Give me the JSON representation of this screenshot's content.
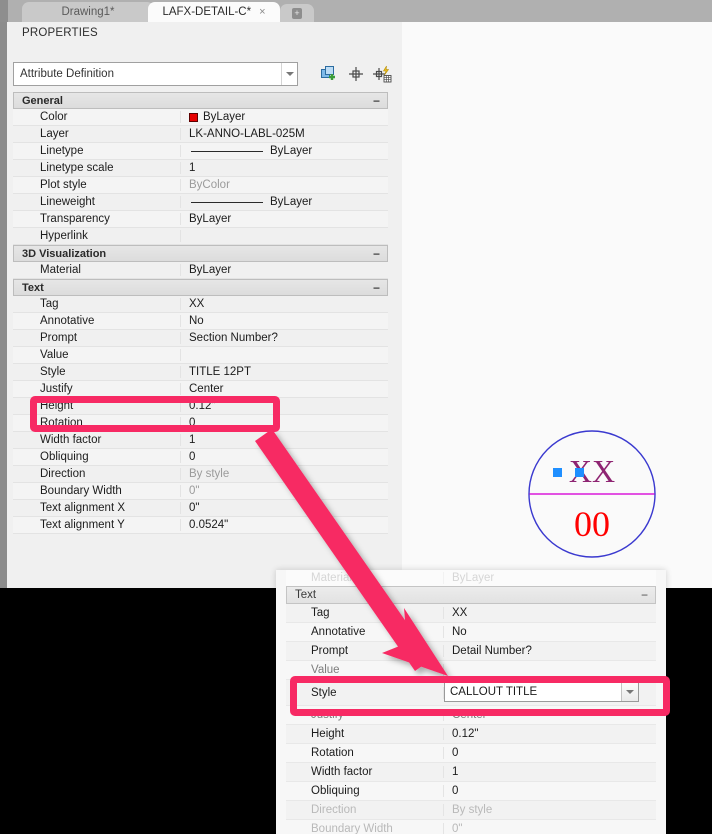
{
  "window": {
    "tabs": [
      {
        "label": "Drawing1*",
        "active": false
      },
      {
        "label": "LAFX-DETAIL-C*",
        "active": true,
        "close": "×"
      }
    ],
    "new_tab_glyph": "+"
  },
  "palette": {
    "title": "PROPERTIES",
    "object_type": "Attribute Definition",
    "toolbar": {
      "select_objects": "select-objects-icon",
      "quick_select": "quick-select-icon",
      "quick_select_calc": "quick-select-calc-icon"
    },
    "categories": [
      {
        "name": "General",
        "collapse": "−",
        "rows": [
          {
            "name": "Color",
            "value": "ByLayer",
            "swatch": "#e60000"
          },
          {
            "name": "Layer",
            "value": "LK-ANNO-LABL-025M"
          },
          {
            "name": "Linetype",
            "value": "ByLayer",
            "line": true
          },
          {
            "name": "Linetype scale",
            "value": "1"
          },
          {
            "name": "Plot style",
            "value": "ByColor",
            "dim": true
          },
          {
            "name": "Lineweight",
            "value": "ByLayer",
            "line": true
          },
          {
            "name": "Transparency",
            "value": "ByLayer"
          },
          {
            "name": "Hyperlink",
            "value": ""
          }
        ]
      },
      {
        "name": "3D Visualization",
        "collapse": "−",
        "rows": [
          {
            "name": "Material",
            "value": "ByLayer"
          }
        ]
      },
      {
        "name": "Text",
        "collapse": "−",
        "rows": [
          {
            "name": "Tag",
            "value": "XX"
          },
          {
            "name": "Annotative",
            "value": "No"
          },
          {
            "name": "Prompt",
            "value": "Section Number?"
          },
          {
            "name": "Value",
            "value": ""
          },
          {
            "name": "Style",
            "value": "TITLE 12PT",
            "highlighted": true
          },
          {
            "name": "Justify",
            "value": "Center"
          },
          {
            "name": "Height",
            "value": "0.12\""
          },
          {
            "name": "Rotation",
            "value": "0"
          },
          {
            "name": "Width factor",
            "value": "1"
          },
          {
            "name": "Obliquing",
            "value": "0"
          },
          {
            "name": "Direction",
            "value": "By style",
            "dim": true
          },
          {
            "name": "Boundary Width",
            "value": "0\"",
            "dim": true
          },
          {
            "name": "Text alignment X",
            "value": "0\""
          },
          {
            "name": "Text alignment Y",
            "value": "0.0524\""
          }
        ]
      }
    ]
  },
  "palette2": {
    "faded_rows": [
      {
        "name": "Material",
        "value": "ByLayer"
      }
    ],
    "category": {
      "name": "Text",
      "collapse": "−"
    },
    "rows": [
      {
        "name": "Tag",
        "value": "XX"
      },
      {
        "name": "Annotative",
        "value": "No"
      },
      {
        "name": "Prompt",
        "value": "Detail Number?"
      },
      {
        "name": "Value",
        "value": "",
        "partial": true
      },
      {
        "name": "Style",
        "value": "CALLOUT TITLE",
        "editing": true
      },
      {
        "name": "Justify",
        "value": "Center",
        "partial": true
      },
      {
        "name": "Height",
        "value": "0.12\""
      },
      {
        "name": "Rotation",
        "value": "0"
      },
      {
        "name": "Width factor",
        "value": "1"
      },
      {
        "name": "Obliquing",
        "value": "0"
      },
      {
        "name": "Direction",
        "value": "By style",
        "dim": true
      },
      {
        "name": "Boundary Width",
        "value": "0\"",
        "dim": true
      }
    ]
  },
  "drawing": {
    "callout_tag": "XX",
    "callout_number": "00",
    "circle_color": "#3a39cf",
    "tag_color": "#8e2472",
    "number_color": "#ff0000",
    "divider_color": "#d91ad9",
    "grip_color": "#1f8fff"
  },
  "annotations": {
    "highlight_color": "#f72a64",
    "arrow_color": "#f72a64"
  }
}
